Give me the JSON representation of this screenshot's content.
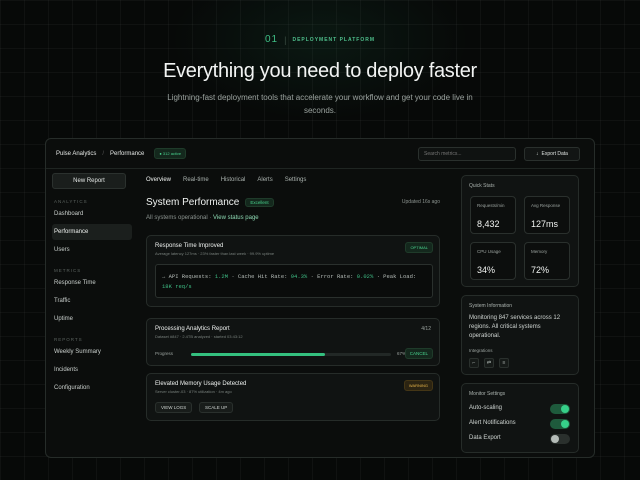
{
  "hero": {
    "number": "01",
    "eyebrow": "DEPLOYMENT PLATFORM",
    "headline": "Everything you need to deploy faster",
    "subtitle": "Lightning-fast deployment tools that accelerate your workflow and get your code live in seconds."
  },
  "topbar": {
    "breadcrumb_root": "Pulse Analytics",
    "breadcrumb_current": "Performance",
    "live_badge": "● 312 active",
    "search_placeholder": "Search metrics...",
    "export_label": "Export Data"
  },
  "sidebar": {
    "new_report": "New Report",
    "analytics_header": "ANALYTICS",
    "analytics_items": [
      "Dashboard",
      "Performance",
      "Users"
    ],
    "metrics_header": "METRICS",
    "metrics_items": [
      "Response Time",
      "Traffic",
      "Uptime"
    ],
    "reports_header": "REPORTS",
    "reports_items": [
      "Weekly Summary",
      "Incidents",
      "Configuration"
    ]
  },
  "main": {
    "tabs": [
      "Overview",
      "Real-time",
      "Historical",
      "Alerts",
      "Settings"
    ],
    "title": "System Performance",
    "title_badge": "Excellent",
    "updated": "Updated 16s ago",
    "status_text": "All systems operational ·",
    "status_link": "View status page",
    "card1": {
      "title": "Response Time Improved",
      "meta": "Average latency 127ms · 23% faster than last week · 99.9% uptime",
      "badge": "OPTIMAL",
      "line1_prefix": "→ API Requests: ",
      "api_requests": "1.2M",
      "line1_mid1": " · Cache Hit Rate: ",
      "cache_hit": "94.3%",
      "line1_mid2": " · Error Rate: ",
      "error_rate": "0.02%",
      "line1_mid3": " · Peak Load:",
      "peak_load": "18K req/s"
    },
    "card2": {
      "title": "Processing Analytics Report",
      "meta": "Dataset #847 · 2.4TB analyzed · started 03:43:12",
      "step": "4/12",
      "progress_label": "Progress",
      "progress_value": 0.67,
      "progress_text": "67%",
      "cancel": "CANCEL"
    },
    "card3": {
      "title": "Elevated Memory Usage Detected",
      "meta": "Server cluster-03 · 87% utilization · 4m ago",
      "badge": "WARNING",
      "btn_view": "VIEW LOGS",
      "btn_scale": "SCALE UP"
    }
  },
  "quick_stats": {
    "title": "Quick Stats",
    "items": [
      {
        "label": "Requests/min",
        "value": "8,432"
      },
      {
        "label": "Avg Response",
        "value": "127ms"
      },
      {
        "label": "CPU Usage",
        "value": "34%"
      },
      {
        "label": "Memory",
        "value": "72%"
      }
    ]
  },
  "system_info": {
    "title": "System Information",
    "text": "Monitoring 847 services across 12 regions. All critical systems operational.",
    "integrations_label": "Integrations",
    "integration_icons": [
      "⌐",
      "⇄",
      "≡"
    ]
  },
  "monitor_settings": {
    "title": "Monitor Settings",
    "rows": [
      {
        "label": "Auto-scaling",
        "on": true
      },
      {
        "label": "Alert Notifications",
        "on": true
      },
      {
        "label": "Data Export",
        "on": false
      }
    ]
  },
  "colors": {
    "accent": "#36d089",
    "warning": "#e7b449",
    "bg": "#070908"
  }
}
